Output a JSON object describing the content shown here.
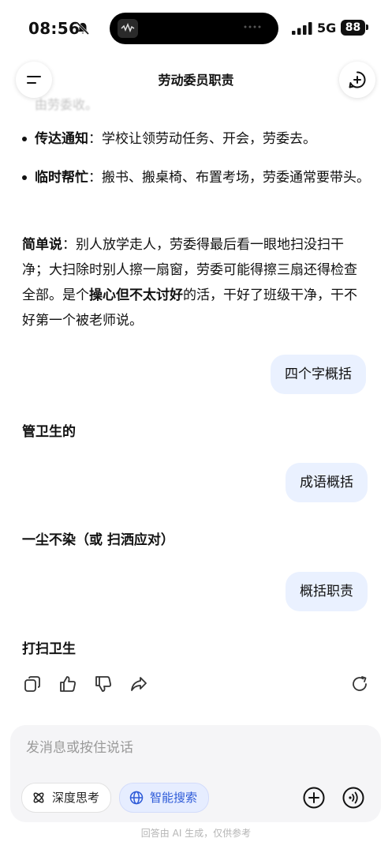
{
  "status_bar": {
    "time": "08:56",
    "network": "5G",
    "battery": "88"
  },
  "header": {
    "title": "劳动委员职责"
  },
  "faded_text": "由劳委收。",
  "bullets": [
    {
      "bold": "传达通知",
      "text": "：学校让领劳动任务、开会，劳委去。"
    },
    {
      "bold": "临时帮忙",
      "text": "：搬书、搬桌椅、布置考场，劳委通常要带头。"
    }
  ],
  "summary": {
    "lead": "简单说",
    "part1": "：别人放学走人，劳委得最后看一眼地扫没扫干净；大扫除时别人擦一扇窗，劳委可能得擦三扇还得检查全部。是个",
    "emphasis": "操心但不太讨好",
    "part2": "的活，干好了班级干净，干不好第一个被老师说。"
  },
  "messages": [
    {
      "role": "user",
      "text": "四个字概括"
    },
    {
      "role": "assistant",
      "text": "管卫生的"
    },
    {
      "role": "user",
      "text": "成语概括"
    },
    {
      "role": "assistant",
      "text": "一尘不染（或 扫洒应对）"
    },
    {
      "role": "user",
      "text": "概括职责"
    },
    {
      "role": "assistant",
      "text": "打扫卫生"
    }
  ],
  "composer": {
    "placeholder": "发消息或按住说话",
    "deep_think": "深度思考",
    "smart_search": "智能搜索"
  },
  "disclaimer": "回答由 AI 生成，仅供参考",
  "icons": {
    "menu": "menu-icon",
    "new_chat": "new-chat-icon",
    "copy": "copy-icon",
    "like": "thumbs-up-icon",
    "dislike": "thumbs-down-icon",
    "share": "share-icon",
    "regenerate": "refresh-icon",
    "deep_think": "atom-icon",
    "search": "globe-icon",
    "add": "plus-icon",
    "voice": "voice-icon"
  },
  "colors": {
    "user_bubble": "#eaf1ff",
    "accent": "#2e5bd8"
  }
}
